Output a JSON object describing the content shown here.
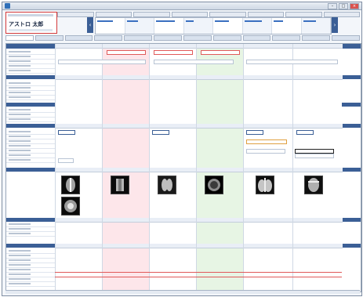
{
  "patient": {
    "name": "アストロ 太郎"
  },
  "icons": {
    "app": "application-icon",
    "nav_prev": "chevron-left-icon",
    "nav_next": "chevron-right-icon"
  },
  "colors": {
    "accent": "#3b5f96",
    "alert": "#d43a3a",
    "pink": "#fde6ea",
    "green": "#e7f5e4"
  }
}
